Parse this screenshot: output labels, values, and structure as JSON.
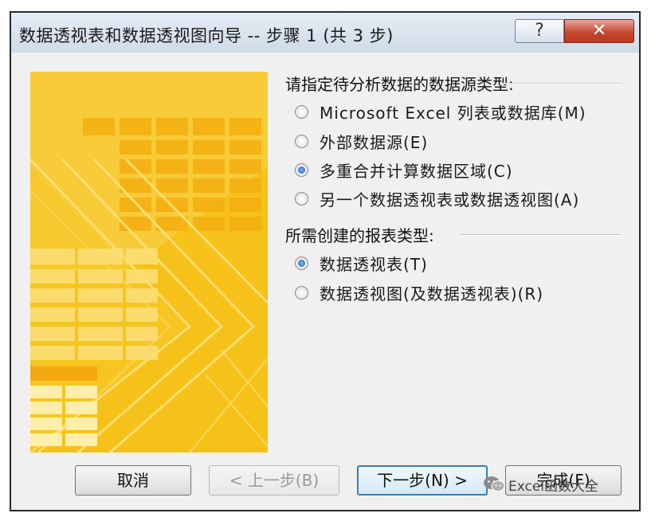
{
  "window": {
    "title": "数据透视表和数据透视图向导 -- 步骤 1 (共 3 步)",
    "help_label": "?",
    "close_label": "✕"
  },
  "source_section": {
    "label": "请指定待分析数据的数据源类型:",
    "options": [
      {
        "label": "Microsoft Excel 列表或数据库(M)",
        "checked": false
      },
      {
        "label": "外部数据源(E)",
        "checked": false
      },
      {
        "label": "多重合并计算数据区域(C)",
        "checked": true
      },
      {
        "label": "另一个数据透视表或数据透视图(A)",
        "checked": false
      }
    ]
  },
  "report_section": {
    "label": "所需创建的报表类型:",
    "options": [
      {
        "label": "数据透视表(T)",
        "checked": true
      },
      {
        "label": "数据透视图(及数据透视表)(R)",
        "checked": false
      }
    ]
  },
  "buttons": {
    "cancel": "取消",
    "back": "< 上一步(B)",
    "next": "下一步(N) >",
    "finish": "完成(F)"
  },
  "watermark": {
    "text": "Excel函数大全",
    "icon": "wechat-icon"
  },
  "colors": {
    "art_yellow": "#f6c21a",
    "close_red": "#c64a33",
    "radio_blue": "#1d5fb8"
  }
}
